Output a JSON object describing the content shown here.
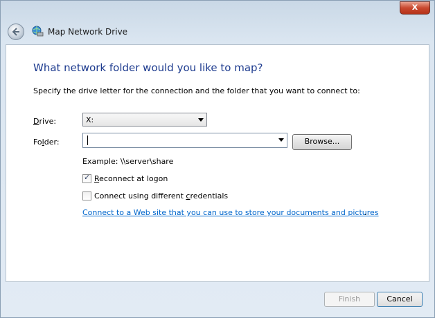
{
  "window": {
    "title": "Map Network Drive"
  },
  "heading": "What network folder would you like to map?",
  "instruction": "Specify the drive letter for the connection and the folder that you want to connect to:",
  "drive": {
    "label_prefix": "",
    "label_underline": "D",
    "label_rest": "rive:",
    "value": "X:"
  },
  "folder": {
    "label_prefix": "Fo",
    "label_underline": "l",
    "label_rest": "der:",
    "value": ""
  },
  "browse_label": "Browse...",
  "example": "Example: \\\\server\\share",
  "reconnect": {
    "label_prefix": "",
    "label_underline": "R",
    "label_rest": "econnect at logon",
    "checked": true
  },
  "credentials": {
    "label_prefix": "Connect using different ",
    "label_underline": "c",
    "label_rest": "redentials",
    "checked": false
  },
  "web_link": "Connect to a Web site that you can use to store your documents and pictures",
  "web_link_suffix": ".",
  "buttons": {
    "finish": "Finish",
    "cancel": "Cancel",
    "close": "x"
  }
}
